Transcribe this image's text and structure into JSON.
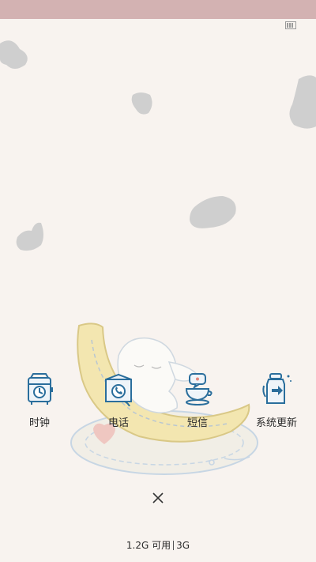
{
  "apps": [
    {
      "label": "时钟",
      "icon": "clock-app-icon"
    },
    {
      "label": "电话",
      "icon": "phone-app-icon"
    },
    {
      "label": "短信",
      "icon": "message-app-icon"
    },
    {
      "label": "系统更新",
      "icon": "system-update-app-icon"
    }
  ],
  "memory": {
    "available": "1.2G 可用",
    "network": "3G"
  },
  "colors": {
    "status_bar": "#d3b2b2",
    "background": "#f8f3ef",
    "icon_blue": "#2a6e9c",
    "banana": "#f3e6b0",
    "spots": "#cfcfcf"
  }
}
